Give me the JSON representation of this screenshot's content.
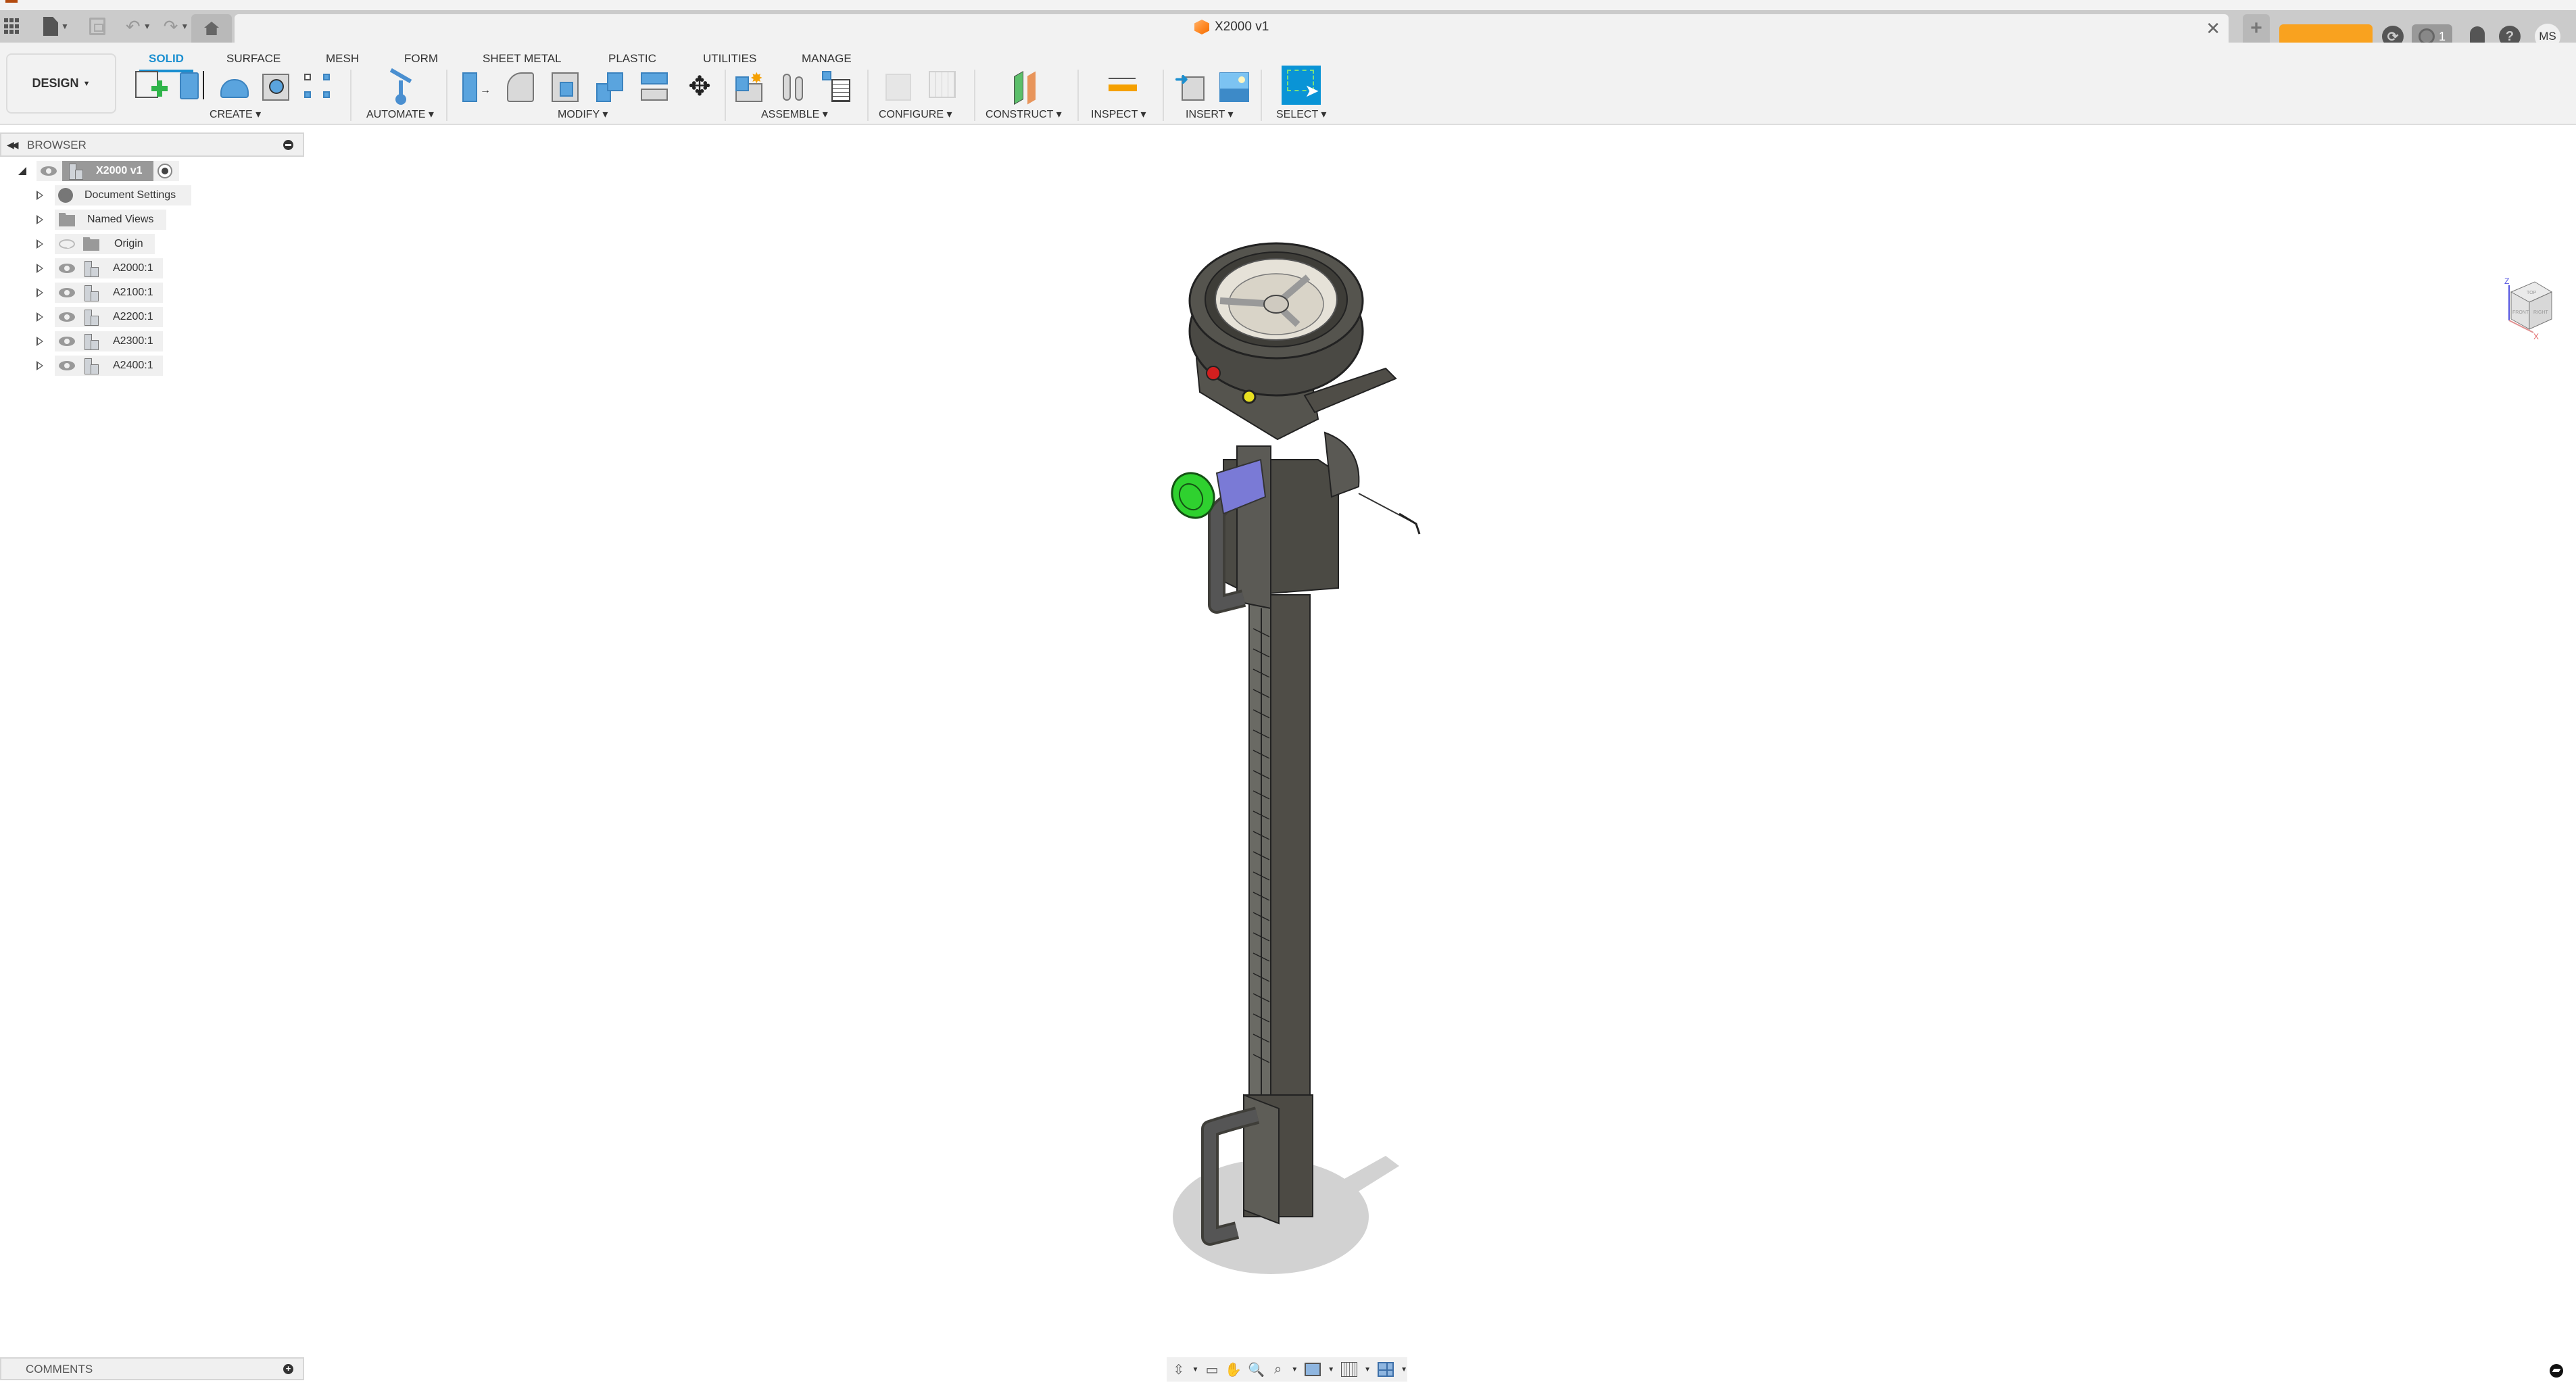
{
  "window": {
    "document_title": "X2000 v1",
    "orange_button_label": "",
    "jobs_count": "1",
    "user_initials": "MS"
  },
  "quick_access": {
    "icons": [
      "grid-menu-icon",
      "file-icon",
      "save-icon",
      "undo-icon",
      "redo-icon",
      "home-icon"
    ]
  },
  "ribbon": {
    "workspace": "DESIGN",
    "tabs": [
      "SOLID",
      "SURFACE",
      "MESH",
      "FORM",
      "SHEET METAL",
      "PLASTIC",
      "UTILITIES",
      "MANAGE"
    ],
    "active_tab": "SOLID",
    "groups": [
      {
        "label": "CREATE",
        "tools": [
          "create-sketch-icon",
          "extrude-icon",
          "revolve-icon",
          "hole-icon",
          "pattern-icon"
        ]
      },
      {
        "label": "AUTOMATE",
        "tools": [
          "automate-icon"
        ]
      },
      {
        "label": "MODIFY",
        "tools": [
          "press-pull-icon",
          "fillet-icon",
          "shell-icon",
          "combine-icon",
          "split-icon",
          "move-icon"
        ]
      },
      {
        "label": "ASSEMBLE",
        "tools": [
          "new-component-icon",
          "joint-icon",
          "bom-icon"
        ]
      },
      {
        "label": "CONFIGURE",
        "tools": [
          "configure-icon",
          "config-table-icon"
        ]
      },
      {
        "label": "CONSTRUCT",
        "tools": [
          "offset-plane-icon"
        ]
      },
      {
        "label": "INSPECT",
        "tools": [
          "measure-icon"
        ]
      },
      {
        "label": "INSERT",
        "tools": [
          "insert-derive-icon",
          "insert-image-icon"
        ]
      },
      {
        "label": "SELECT",
        "tools": [
          "select-icon"
        ]
      }
    ]
  },
  "browser": {
    "title": "BROWSER",
    "root": {
      "label": "X2000 v1"
    },
    "items": [
      {
        "label": "Document Settings",
        "icon": "gear-icon",
        "visible": null
      },
      {
        "label": "Named Views",
        "icon": "folder-icon",
        "visible": null
      },
      {
        "label": "Origin",
        "icon": "folder-icon",
        "visible": false
      },
      {
        "label": "A2000:1",
        "icon": "component-icon",
        "visible": true
      },
      {
        "label": "A2100:1",
        "icon": "component-icon",
        "visible": true
      },
      {
        "label": "A2200:1",
        "icon": "component-icon",
        "visible": true
      },
      {
        "label": "A2300:1",
        "icon": "component-icon",
        "visible": true
      },
      {
        "label": "A2400:1",
        "icon": "component-icon",
        "visible": true
      }
    ]
  },
  "viewcube": {
    "faces": [
      "TOP",
      "FRONT",
      "RIGHT"
    ],
    "axes": [
      "Z",
      "X"
    ]
  },
  "comments": {
    "title": "COMMENTS"
  },
  "navbar": {
    "tools": [
      "orbit-icon",
      "look-at-icon",
      "pan-icon",
      "zoom-icon",
      "fit-icon",
      "display-settings-icon",
      "grid-icon",
      "viewports-icon"
    ]
  },
  "colors": {
    "accent": "#1b8fd0",
    "model_body": "#5b5a55",
    "grip_green": "#2fd12f",
    "bracket_purple": "#7a7ad6",
    "button_red": "#d21f1f",
    "button_yellow": "#e8e020",
    "orange_button": "#f9a21f"
  }
}
